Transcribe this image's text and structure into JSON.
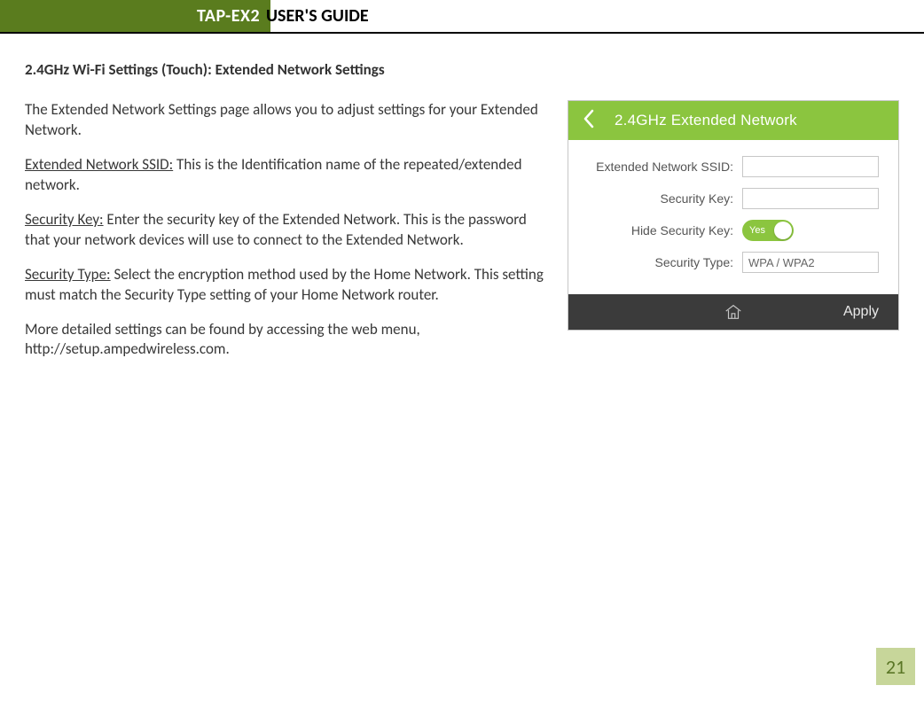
{
  "header": {
    "product": "TAP-EX2",
    "title": "USER'S GUIDE"
  },
  "section_title": "2.4GHz Wi-Fi Settings (Touch): Extended Network Settings",
  "paragraphs": {
    "intro": "The Extended Network Settings page allows you to adjust settings for your Extended Network.",
    "ssid_label": "Extended Network SSID:",
    "ssid_text": " This is the Identification name of the repeated/extended network.",
    "seckey_label": "Security Key:",
    "seckey_text": " Enter the security key of the Extended Network. This is the password that your network devices will use to connect to the Extended Network.",
    "sectype_label": "Security Type:",
    "sectype_text": " Select the encryption method used by the Home Network. This setting must match the Security Type setting of your Home Network router.",
    "more": "More detailed settings can be found by accessing the web menu, http://setup.ampedwireless.com."
  },
  "touch_panel": {
    "title": "2.4GHz Extended Network",
    "fields": {
      "ssid_label": "Extended Network SSID:",
      "ssid_value": "",
      "seckey_label": "Security Key:",
      "seckey_value": "",
      "hidekey_label": "Hide Security Key:",
      "hidekey_toggle": "Yes",
      "sectype_label": "Security Type:",
      "sectype_value": "WPA / WPA2"
    },
    "footer": {
      "apply": "Apply"
    }
  },
  "page_number": "21"
}
